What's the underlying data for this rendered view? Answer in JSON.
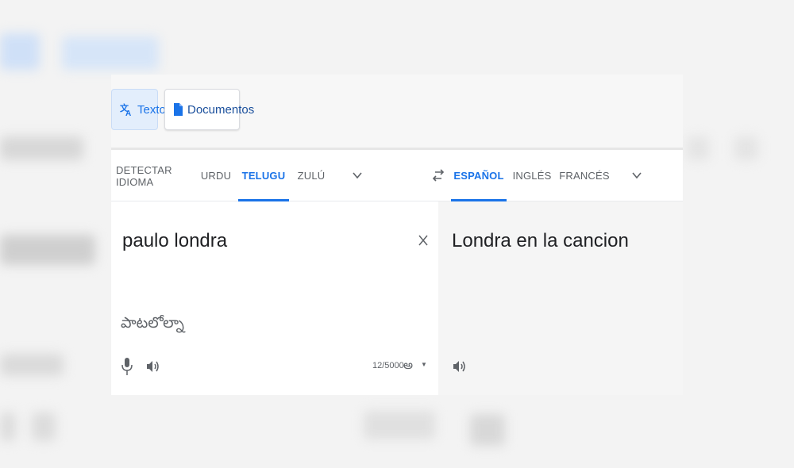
{
  "mode_tabs": {
    "text_label": "Texto",
    "documents_label": "Documentos"
  },
  "source_langs": [
    {
      "label": "DETECTAR IDIOMA",
      "active": false
    },
    {
      "label": "URDU",
      "active": false
    },
    {
      "label": "TELUGU",
      "active": true
    },
    {
      "label": "ZULÚ",
      "active": false
    }
  ],
  "target_langs": [
    {
      "label": "ESPAÑOL",
      "active": true
    },
    {
      "label": "INGLÉS",
      "active": false
    },
    {
      "label": "FRANCÉS",
      "active": false
    }
  ],
  "source": {
    "text": "paulo londra",
    "transliteration": "పాటలోల్నా",
    "char_count": "12/5000",
    "input_tool_glyph": "అ"
  },
  "target": {
    "text": "Londra en la cancion"
  },
  "colors": {
    "accent": "#1a73e8",
    "muted": "#5f6368"
  },
  "icons": [
    "translate-icon",
    "document-icon",
    "chevron-down-icon",
    "swap-icon",
    "close-icon",
    "microphone-icon",
    "speaker-icon"
  ]
}
